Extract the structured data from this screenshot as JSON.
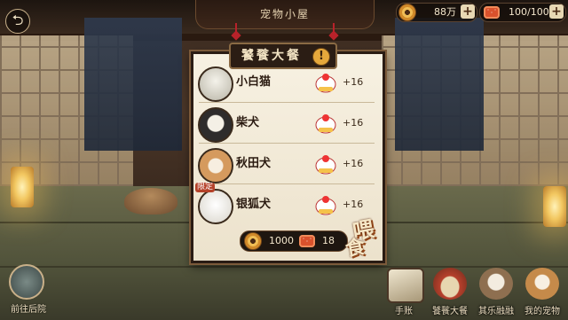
{
  "header": {
    "title": "宠物小屋"
  },
  "resources": [
    {
      "name": "coins",
      "value": "88万",
      "icon": "coin-icon"
    },
    {
      "name": "food",
      "value": "100/100",
      "icon": "fish-food-icon"
    }
  ],
  "panel": {
    "title": "饕餮大餐",
    "pets": [
      {
        "name": "小白猫",
        "bonus": "+16",
        "avatar": "white-cat-avatar-icon",
        "color": "#d8d6cc"
      },
      {
        "name": "柴犬",
        "bonus": "+16",
        "avatar": "shiba-avatar-icon",
        "color": "#3a3838"
      },
      {
        "name": "秋田犬",
        "bonus": "+16",
        "avatar": "akita-avatar-icon",
        "color": "#d6a168"
      },
      {
        "name": "银狐犬",
        "bonus": "+16",
        "avatar": "silver-fox-dog-avatar-icon",
        "color": "#f2efe8",
        "tag": "限定"
      }
    ],
    "cost": {
      "coins": "1000",
      "food": "18"
    },
    "feed_button": [
      "喂",
      "食"
    ]
  },
  "nav": {
    "left": {
      "label": "前往后院"
    },
    "items": [
      {
        "label": "手账",
        "color": "#c8b894"
      },
      {
        "label": "饕餮大餐",
        "color": "#a63a2a"
      },
      {
        "label": "其乐融融",
        "color": "#9a7a58"
      },
      {
        "label": "我的宠物",
        "color": "#c08a4a"
      }
    ]
  },
  "colors": {
    "accent": "#b8222a",
    "panel_bg": "#f4eddb",
    "gold": "#e5a83c"
  }
}
